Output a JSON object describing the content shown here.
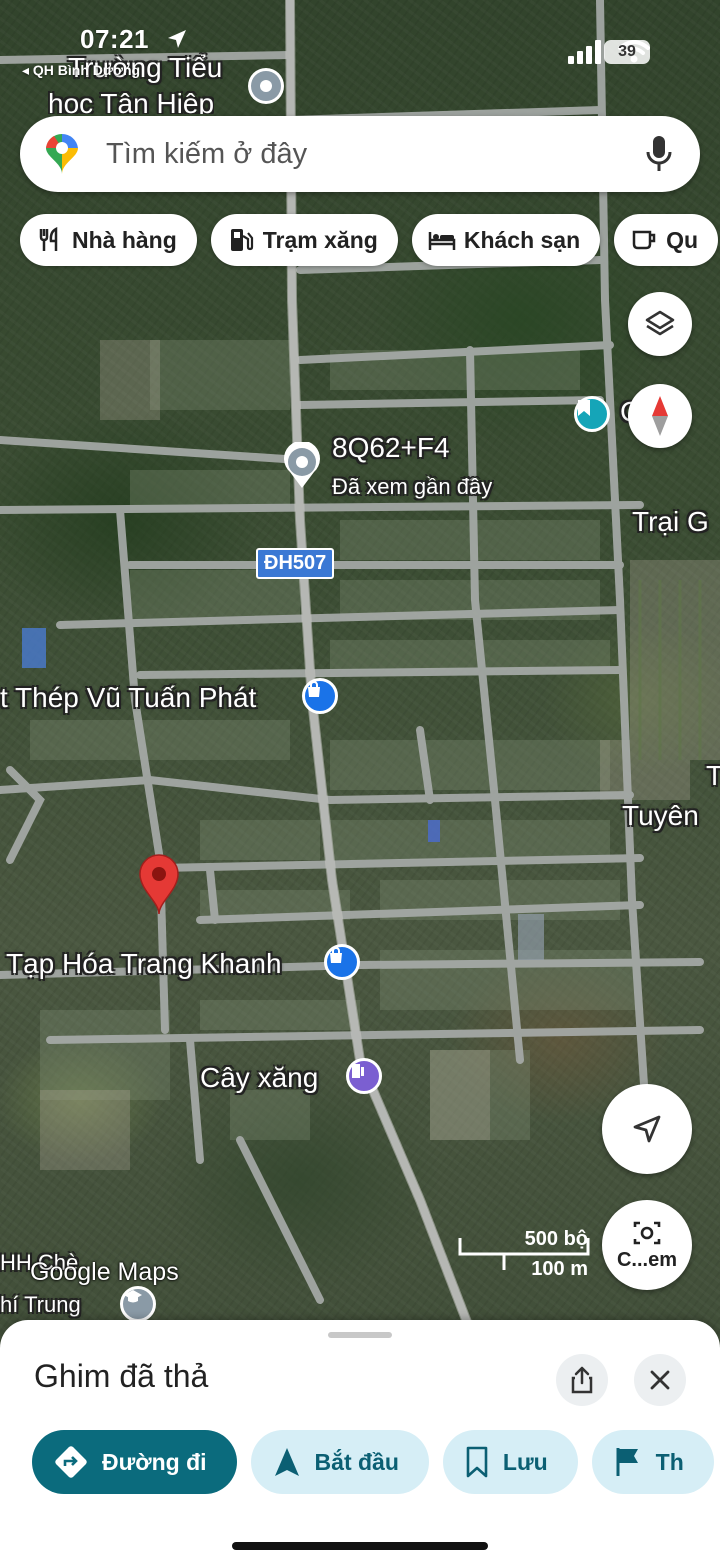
{
  "status_bar": {
    "time": "07:21",
    "back_app": "◂ QH Bình Dương",
    "battery": "39"
  },
  "search": {
    "placeholder": "Tìm kiếm ở đây"
  },
  "chips": [
    {
      "label": "Nhà hàng",
      "icon": "restaurant-icon"
    },
    {
      "label": "Trạm xăng",
      "icon": "gas-station-icon"
    },
    {
      "label": "Khách sạn",
      "icon": "hotel-icon"
    },
    {
      "label": "Qu",
      "icon": "coffee-icon"
    }
  ],
  "map": {
    "labels": {
      "school": "Trường Tiểu",
      "school_line2": "học Tân Hiệp",
      "plus_code": "8Q62+F4",
      "recent": "Đã xem gần đây",
      "road": "ĐH507",
      "steel": "t Thép Vũ Tuấn Phát",
      "grocery": "Tạp Hóa Trang Khanh",
      "gas": "Cây xăng",
      "farm": "Trại G",
      "tuyen": "Tuyên",
      "saved_place": "C",
      "right_t": "T",
      "bottom_left1": "HH Chè",
      "bottom_left2": "hí Trung"
    },
    "scale": {
      "feet": "500 bộ",
      "meters": "100 m"
    },
    "watermark": "Google Maps",
    "lens_label": "C...em",
    "colors": {
      "pin": "#e53935",
      "poi_blue": "#1a73e8",
      "bookmark": "#15a5b8",
      "road": "#a8acaa"
    }
  },
  "sheet": {
    "title": "Ghim đã thả",
    "actions": [
      {
        "label": "Đường đi",
        "icon": "directions-icon"
      },
      {
        "label": "Bắt đầu",
        "icon": "navigation-arrow-icon"
      },
      {
        "label": "Lưu",
        "icon": "bookmark-icon"
      },
      {
        "label": "Th",
        "icon": "flag-icon"
      }
    ]
  }
}
